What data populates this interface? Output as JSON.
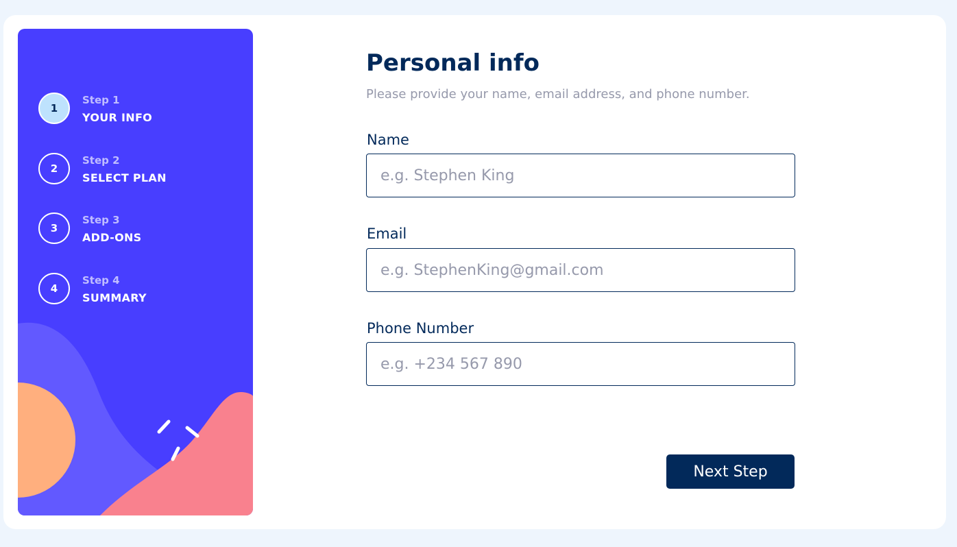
{
  "sidebar": {
    "steps": [
      {
        "number": "1",
        "label": "Step 1",
        "title": "YOUR INFO",
        "active": true
      },
      {
        "number": "2",
        "label": "Step 2",
        "title": "SELECT PLAN",
        "active": false
      },
      {
        "number": "3",
        "label": "Step 3",
        "title": "ADD-ONS",
        "active": false
      },
      {
        "number": "4",
        "label": "Step 4",
        "title": "SUMMARY",
        "active": false
      }
    ]
  },
  "form": {
    "title": "Personal info",
    "subtitle": "Please provide your name, email address, and phone number.",
    "fields": {
      "name": {
        "label": "Name",
        "placeholder": "e.g. Stephen King",
        "value": ""
      },
      "email": {
        "label": "Email",
        "placeholder": "e.g. StephenKing@gmail.com",
        "value": ""
      },
      "phone": {
        "label": "Phone Number",
        "placeholder": "e.g. +234 567 890",
        "value": ""
      }
    },
    "next_label": "Next Step"
  },
  "colors": {
    "sidebar_bg": "#483eff",
    "active_step_bg": "#bee2fd",
    "marine_blue": "#02295a",
    "cool_gray": "#9699ab",
    "decor_purple": "#6259ff",
    "decor_orange": "#ffaf7e",
    "decor_pink": "#f9818e"
  }
}
